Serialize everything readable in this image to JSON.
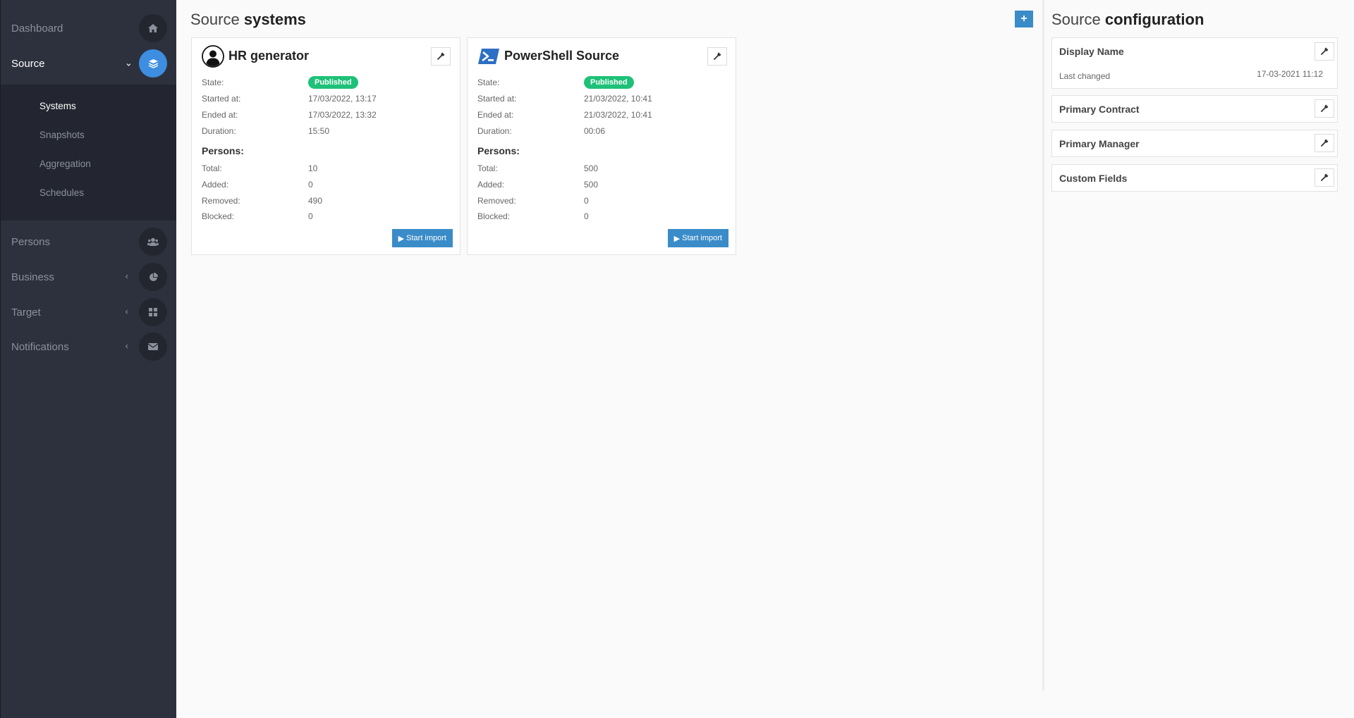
{
  "sidebar": {
    "items": [
      {
        "label": "Dashboard",
        "icon": "home-icon"
      },
      {
        "label": "Source",
        "icon": "layers-icon"
      },
      {
        "label": "Persons",
        "icon": "users-icon"
      },
      {
        "label": "Business",
        "icon": "pie-chart-icon"
      },
      {
        "label": "Target",
        "icon": "grid-icon"
      },
      {
        "label": "Notifications",
        "icon": "envelope-icon"
      }
    ],
    "submenu": [
      "Systems",
      "Snapshots",
      "Aggregation",
      "Schedules"
    ]
  },
  "main": {
    "title_light": "Source",
    "title_bold": "systems",
    "add_label": "+",
    "cards": [
      {
        "name": "HR generator",
        "logo": "user-avatar-icon",
        "state_label": "State:",
        "state": "Published",
        "started_label": "Started at:",
        "started": "17/03/2022, 13:17",
        "ended_label": "Ended at:",
        "ended": "17/03/2022, 13:32",
        "duration_label": "Duration:",
        "duration": "15:50",
        "persons_label": "Persons:",
        "total_label": "Total:",
        "total": "10",
        "added_label": "Added:",
        "added": "0",
        "removed_label": "Removed:",
        "removed": "490",
        "blocked_label": "Blocked:",
        "blocked": "0",
        "import_label": "Start import"
      },
      {
        "name": "PowerShell Source",
        "logo": "powershell-icon",
        "state_label": "State:",
        "state": "Published",
        "started_label": "Started at:",
        "started": "21/03/2022, 10:41",
        "ended_label": "Ended at:",
        "ended": "21/03/2022, 10:41",
        "duration_label": "Duration:",
        "duration": "00:06",
        "persons_label": "Persons:",
        "total_label": "Total:",
        "total": "500",
        "added_label": "Added:",
        "added": "500",
        "removed_label": "Removed:",
        "removed": "0",
        "blocked_label": "Blocked:",
        "blocked": "0",
        "import_label": "Start import"
      }
    ]
  },
  "config": {
    "title_light": "Source",
    "title_bold": "configuration",
    "items": [
      {
        "title": "Display Name",
        "sub_label": "Last changed",
        "date": "17-03-2021 11:12"
      },
      {
        "title": "Primary Contract"
      },
      {
        "title": "Primary Manager"
      },
      {
        "title": "Custom Fields"
      }
    ]
  },
  "colors": {
    "sidebar_bg": "#2d313d",
    "submenu_bg": "#232630",
    "accent_blue": "#3d8ee0",
    "button_blue": "#3a8cc8",
    "published_green": "#1ec178"
  }
}
